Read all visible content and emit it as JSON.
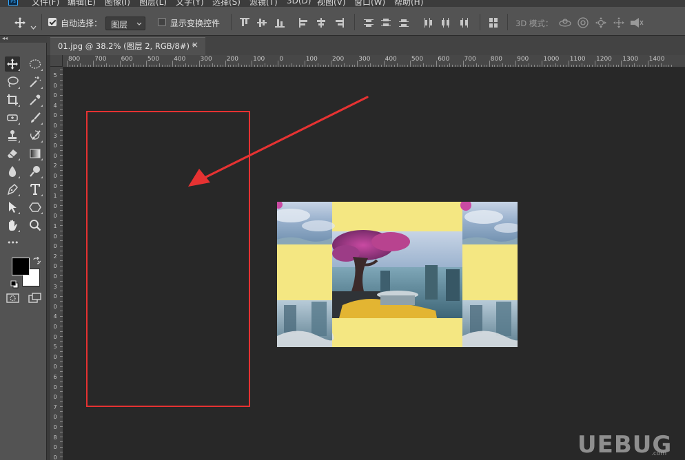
{
  "menu": {
    "ps_logo": "Ps",
    "items": [
      "文件(F)",
      "编辑(E)",
      "图像(I)",
      "图层(L)",
      "文字(Y)",
      "选择(S)",
      "滤镜(T)",
      "3D(D)",
      "视图(V)",
      "窗口(W)",
      "帮助(H)"
    ]
  },
  "options": {
    "auto_select_label": "自动选择：",
    "auto_select_checked": true,
    "auto_select_target": "图层",
    "show_transform_label": "显示变换控件",
    "show_transform_checked": false,
    "mode_3d_label": "3D 模式："
  },
  "document": {
    "tab_title": "01.jpg @ 38.2% (图层 2, RGB/8#) *",
    "close_glyph": "×"
  },
  "ruler": {
    "h_labels": [
      "800",
      "700",
      "600",
      "500",
      "400",
      "300",
      "200",
      "100",
      "0",
      "100",
      "200",
      "300",
      "400",
      "500",
      "600",
      "700",
      "800",
      "900",
      "1000",
      "1100",
      "1200",
      "1300",
      "1400"
    ],
    "v_labels": [
      "5",
      "0",
      "0",
      "4",
      "0",
      "0",
      "3",
      "0",
      "0",
      "2",
      "0",
      "0",
      "1",
      "0",
      "0",
      "1",
      "0",
      "0",
      "2",
      "0",
      "0",
      "3",
      "0",
      "0",
      "4",
      "0",
      "0",
      "5",
      "0",
      "0",
      "6",
      "0",
      "0",
      "7",
      "0",
      "0",
      "8",
      "0",
      "0"
    ]
  },
  "toolbar": {
    "collapse_glyph": "◂◂",
    "more_glyph": "•••",
    "foreground_color": "#000000",
    "background_color": "#ffffff"
  },
  "annotation": {
    "highlight_color": "#e63232"
  },
  "watermark": {
    "text": "UEBUG",
    "sub": ".com"
  }
}
